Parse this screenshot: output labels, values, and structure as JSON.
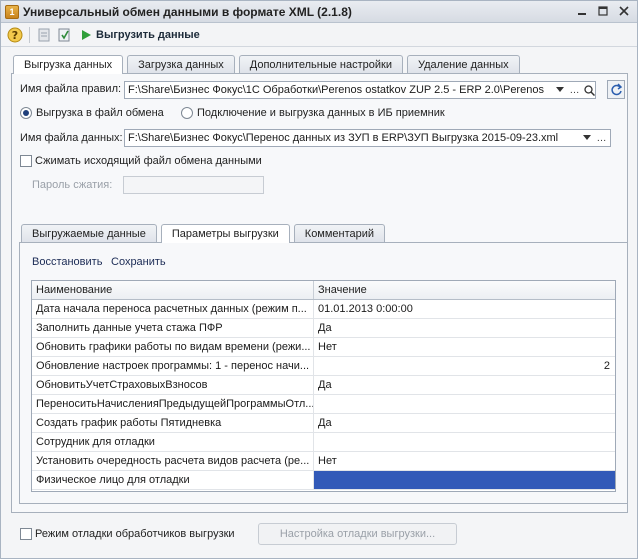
{
  "window": {
    "title": "Универсальный обмен данными в формате XML (2.1.8)",
    "buttons": {
      "minimize": "_",
      "maximize": "□",
      "close": "✕"
    }
  },
  "toolbar": {
    "run_label": "Выгрузить данные"
  },
  "main_tabs": [
    {
      "label": "Выгрузка данных"
    },
    {
      "label": "Загрузка данных"
    },
    {
      "label": "Дополнительные настройки"
    },
    {
      "label": "Удаление данных"
    }
  ],
  "export": {
    "rules_file_label": "Имя файла правил:",
    "rules_file_value": "F:\\Share\\Бизнес Фокус\\1С Обработки\\Perenos ostatkov ZUP 2.5 - ERP 2.0\\Perenos",
    "mode_file_label": "Выгрузка в файл обмена",
    "mode_ib_label": "Подключение и выгрузка данных в ИБ приемник",
    "data_file_label": "Имя файла данных:",
    "data_file_value": "F:\\Share\\Бизнес Фокус\\Перенос данных из ЗУП в ERP\\ЗУП Выгрузка 2015-09-23.xml",
    "compress_label": "Сжимать исходящий файл обмена данными",
    "password_label": "Пароль сжатия:",
    "password_value": ""
  },
  "sub_tabs": [
    {
      "label": "Выгружаемые данные"
    },
    {
      "label": "Параметры выгрузки"
    },
    {
      "label": "Комментарий"
    }
  ],
  "params": {
    "restore_label": "Восстановить",
    "save_label": "Сохранить",
    "columns": {
      "name": "Наименование",
      "value": "Значение"
    },
    "rows": [
      {
        "name": "Дата начала переноса расчетных данных  (режим п...",
        "value": "01.01.2013 0:00:00"
      },
      {
        "name": "Заполнить данные учета стажа ПФР",
        "value": "Да"
      },
      {
        "name": "Обновить графики работы по видам времени  (режи...",
        "value": "Нет"
      },
      {
        "name": "Обновление настроек программы: 1 - перенос начи...",
        "value": "2"
      },
      {
        "name": "ОбновитьУчетСтраховыхВзносов",
        "value": "Да"
      },
      {
        "name": "ПереноситьНачисленияПредыдущейПрограммыОтл...",
        "value": ""
      },
      {
        "name": "Создать график работы Пятидневка",
        "value": "Да"
      },
      {
        "name": "Сотрудник для отладки",
        "value": ""
      },
      {
        "name": "Установить очередность расчета видов расчета  (ре...",
        "value": "Нет"
      },
      {
        "name": "Физическое лицо для отладки",
        "value": ""
      }
    ]
  },
  "footer": {
    "debug_mode_label": "Режим отладки обработчиков выгрузки",
    "debug_settings_label": "Настройка отладки выгрузки..."
  },
  "colors": {
    "selection": "#3159b8",
    "run_icon": "#2f9e3a"
  }
}
